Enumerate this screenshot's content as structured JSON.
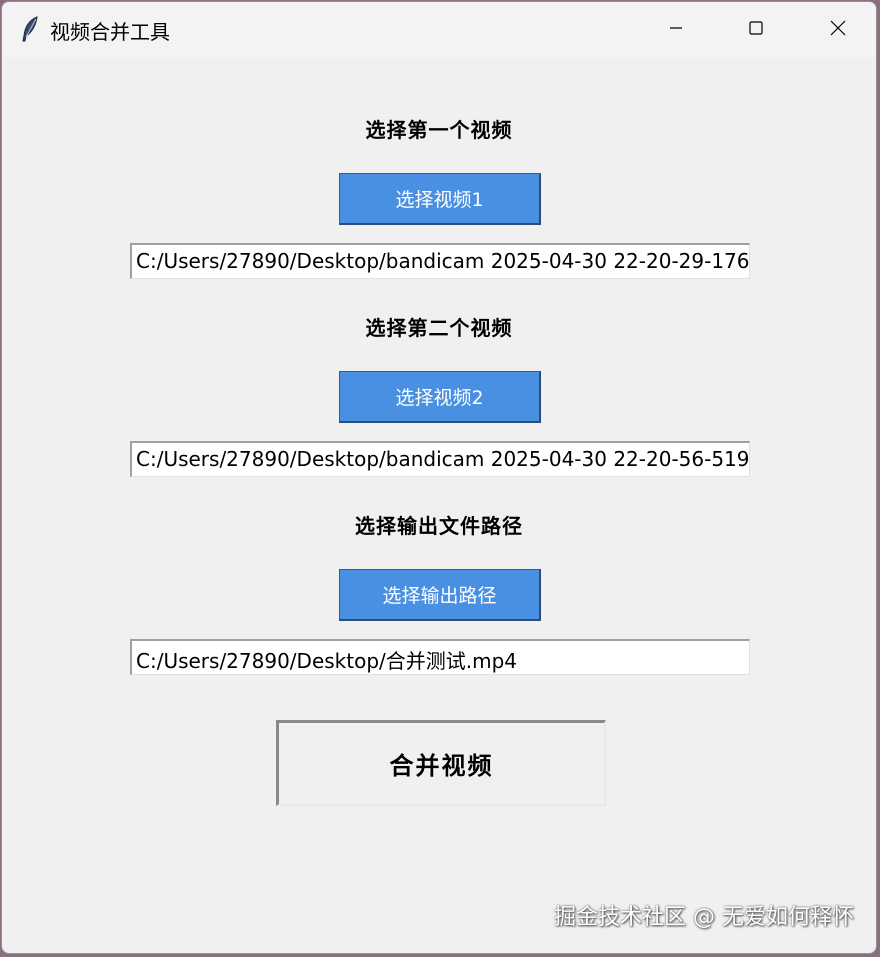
{
  "window": {
    "title": "视频合并工具"
  },
  "section1": {
    "heading": "选择第一个视频",
    "button_label": "选择视频1",
    "path_value": "C:/Users/27890/Desktop/bandicam 2025-04-30 22-20-29-176"
  },
  "section2": {
    "heading": "选择第二个视频",
    "button_label": "选择视频2",
    "path_value": "C:/Users/27890/Desktop/bandicam 2025-04-30 22-20-56-519"
  },
  "section3": {
    "heading": "选择输出文件路径",
    "button_label": "选择输出路径",
    "path_value": "C:/Users/27890/Desktop/合并测试.mp4"
  },
  "merge_button_label": "合并视频",
  "watermark": "掘金技术社区 @ 无爱如何释怀",
  "icons": {
    "app": "feather-icon",
    "minimize": "minimize-icon",
    "maximize": "maximize-icon",
    "close": "close-icon"
  },
  "colors": {
    "accent_button": "#4a90e2",
    "window_bg": "#f0f0f0"
  }
}
